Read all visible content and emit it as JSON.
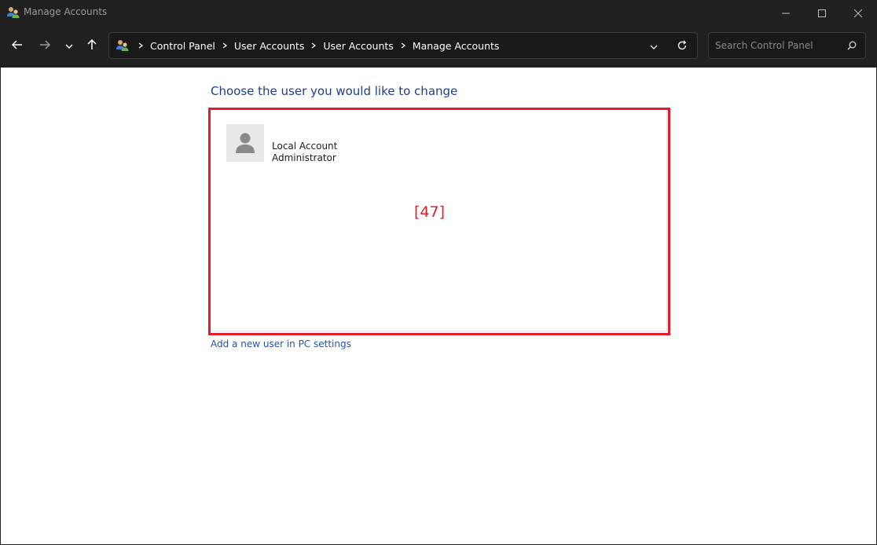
{
  "window": {
    "title": "Manage Accounts",
    "controls": [
      "minimize",
      "maximize",
      "close"
    ]
  },
  "navigation": {
    "buttons": [
      "back-arrow-icon",
      "forward-arrow-icon",
      "recent-locations-chevron-icon",
      "up-arrow-icon"
    ],
    "breadcrumbs": [
      "Control Panel",
      "User Accounts",
      "User Accounts",
      "Manage Accounts"
    ],
    "search_placeholder": "Search Control Panel"
  },
  "main": {
    "heading": "Choose the user you would like to change",
    "marker": "[47]",
    "accounts": [
      {
        "name": "Local Account",
        "role": "Administrator"
      }
    ],
    "add_user_link": "Add a new user in PC settings"
  },
  "colors": {
    "chrome_bg": "#202020",
    "heading": "#1e3e8c",
    "link": "#1a56b8",
    "highlight": "#e01e2b"
  }
}
